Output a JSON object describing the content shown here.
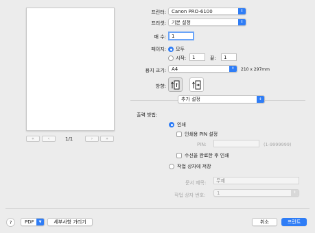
{
  "preview": {
    "page_indicator": "1/1"
  },
  "printer": {
    "label": "프린터:",
    "value": "Canon PRO-6100"
  },
  "preset": {
    "label": "프리셋:",
    "value": "기본 설정"
  },
  "copies": {
    "label": "매 수:",
    "value": "1"
  },
  "pages": {
    "label": "페이지:",
    "all_label": "모두",
    "from_label": "시작:",
    "from_value": "1",
    "to_label": "끝:",
    "to_value": "1"
  },
  "paper_size": {
    "label": "용지 크기:",
    "value": "A4",
    "dimensions": "210 x 297mm"
  },
  "orientation": {
    "label": "방향:"
  },
  "section_popup": {
    "value": "추가 설정"
  },
  "output": {
    "label": "출력 방법:",
    "print_label": "인쇄",
    "pin_setting_label": "인쇄용 PIN 설정",
    "pin_label": "PIN:",
    "pin_range": "(1-9999999)",
    "print_after_receive_label": "수신을 완료한 후 인쇄",
    "save_box_label": "작업 상자에 저장",
    "doc_title_label": "문서 제목:",
    "doc_title_value": "무제",
    "box_number_label": "작업 상자 번호:",
    "box_number_value": "1"
  },
  "footer": {
    "help": "?",
    "pdf_label": "PDF",
    "details_label": "세부사항 가리기",
    "cancel_label": "취소",
    "print_label": "프린트"
  }
}
